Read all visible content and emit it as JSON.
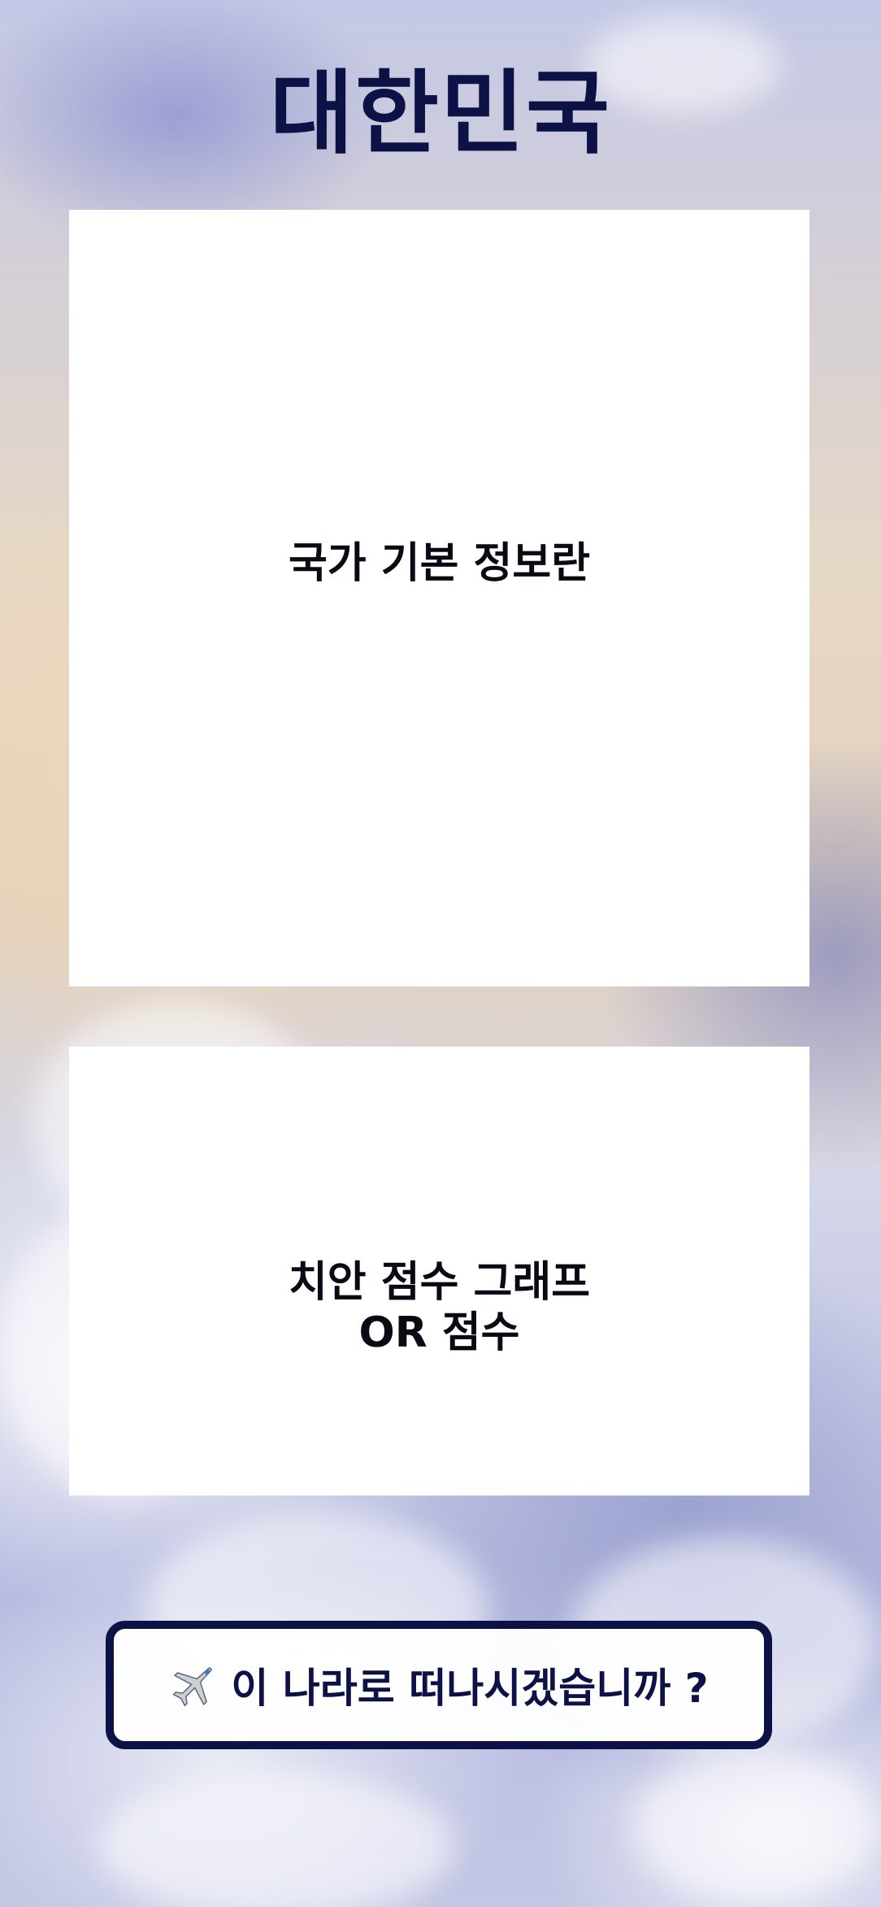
{
  "header": {
    "country_name": "대한민국"
  },
  "cards": {
    "basic_info_label": "국가 기본 정보란",
    "safety_label_line1": "치안 점수 그래프",
    "safety_label_line2": "OR 점수"
  },
  "action": {
    "depart_label": "이 나라로 떠나시겠습니까 ?",
    "icon": "airplane-icon"
  },
  "colors": {
    "title": "#0c1146",
    "button_border": "#0c1146",
    "card_background": "#ffffff"
  }
}
